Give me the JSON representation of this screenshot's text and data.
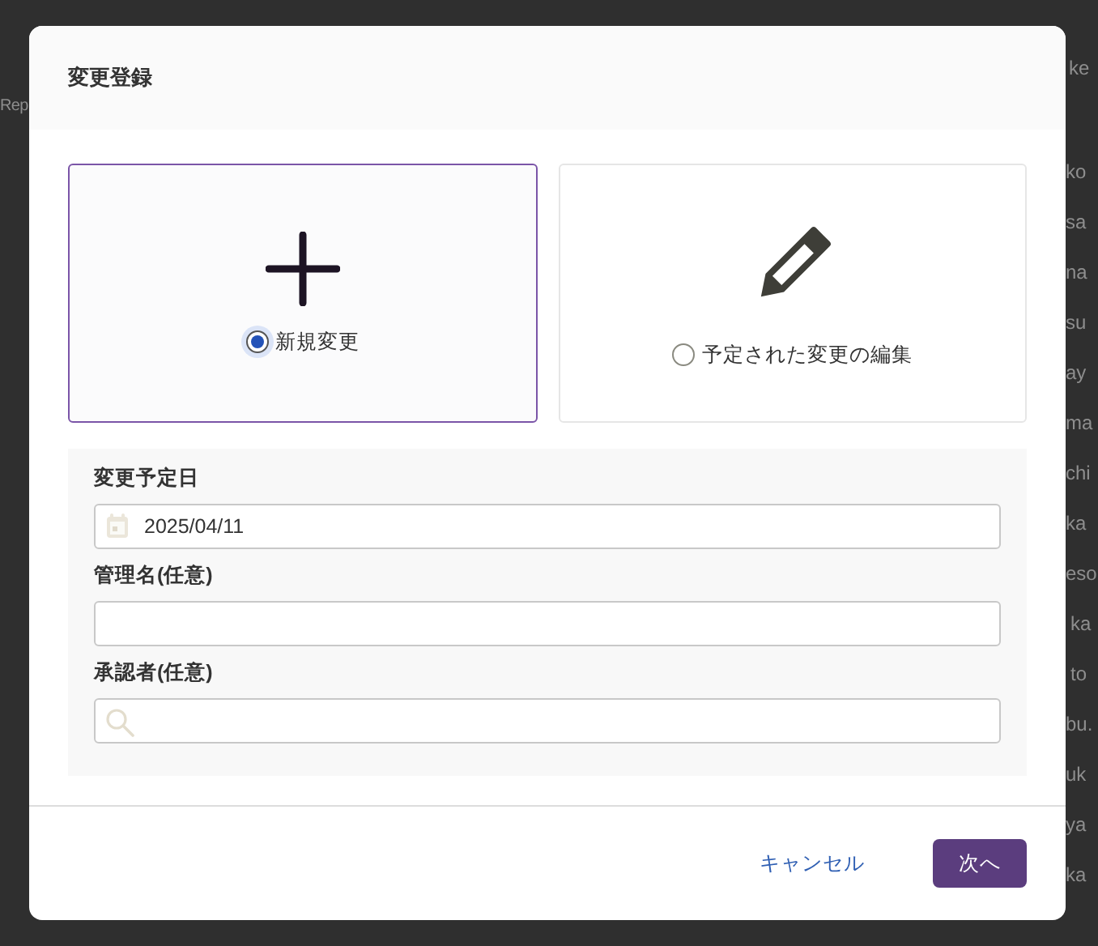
{
  "background": {
    "header_fragment": "ke",
    "left_fragment": "Rep",
    "right_column": [
      "ko",
      "sa",
      "na",
      "su",
      "ay",
      "ma",
      "chi",
      "ka",
      "eso",
      "ka",
      "to",
      "bu.",
      "uk",
      "ya",
      "ka"
    ]
  },
  "dialog": {
    "title": "変更登録",
    "options": [
      {
        "kind": "new",
        "label": "新規変更",
        "selected": true
      },
      {
        "kind": "edit",
        "label": "予定された変更の編集",
        "selected": false
      }
    ],
    "fields": [
      {
        "kind": "date",
        "label": "変更予定日",
        "value": "2025/04/11"
      },
      {
        "kind": "text",
        "label": "管理名(任意)"
      },
      {
        "kind": "search",
        "label": "承認者(任意)"
      }
    ],
    "buttons": [
      {
        "kind": "secondary",
        "label": "キャンセル"
      },
      {
        "kind": "primary",
        "label": "次へ"
      }
    ]
  }
}
